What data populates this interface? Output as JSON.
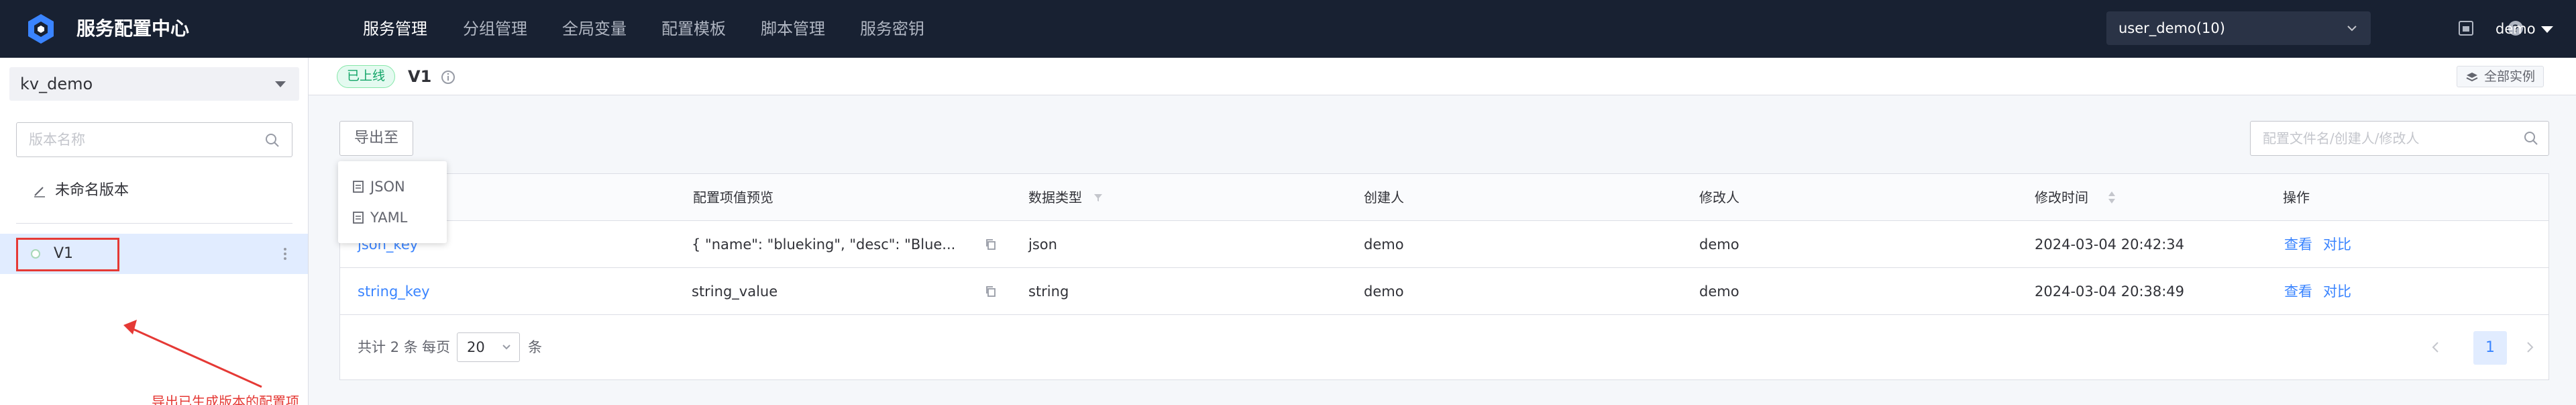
{
  "app": {
    "title": "服务配置中心"
  },
  "nav": {
    "items": [
      {
        "label": "服务管理",
        "active": true
      },
      {
        "label": "分组管理",
        "active": false
      },
      {
        "label": "全局变量",
        "active": false
      },
      {
        "label": "配置模板",
        "active": false
      },
      {
        "label": "脚本管理",
        "active": false
      },
      {
        "label": "服务密钥",
        "active": false
      }
    ]
  },
  "header": {
    "business": "user_demo(10)",
    "user": "demo"
  },
  "sidebar": {
    "service": "kv_demo",
    "search_placeholder": "版本名称",
    "unnamed_label": "未命名版本",
    "versions": [
      {
        "label": "V1",
        "selected": true
      }
    ]
  },
  "annotation": {
    "text": "导出已生成版本的配置项",
    "color": "#e53935"
  },
  "version_header": {
    "status": "已上线",
    "name": "V1",
    "all_instances": "全部实例"
  },
  "toolbar": {
    "export_label": "导出至",
    "search_placeholder": "配置文件名/创建人/修改人"
  },
  "export_menu": {
    "items": [
      "JSON",
      "YAML"
    ]
  },
  "table": {
    "columns": [
      "配置项值预览",
      "数据类型",
      "创建人",
      "修改人",
      "修改时间",
      "操作"
    ],
    "rows": [
      {
        "key": "json_key",
        "value": "{ \"name\": \"blueking\", \"desc\": \"Blue...",
        "type": "json",
        "creator": "demo",
        "modifier": "demo",
        "time": "2024-03-04 20:42:34",
        "view": "查看",
        "diff": "对比"
      },
      {
        "key": "string_key",
        "value": "string_value",
        "type": "string",
        "creator": "demo",
        "modifier": "demo",
        "time": "2024-03-04 20:38:49",
        "view": "查看",
        "diff": "对比"
      }
    ]
  },
  "pagination": {
    "total_prefix": "共计",
    "total": "2",
    "total_suffix": "条",
    "per_page_label": "每页",
    "page_size": "20",
    "per_page_suffix": "条",
    "current_page": "1"
  },
  "colors": {
    "topbar": "#182132",
    "accent": "#3a84ff",
    "success": "#14a568",
    "annotation": "#e53935"
  },
  "icons": [
    "logo-icon",
    "chevron-down-icon",
    "fullscreen-icon",
    "help-icon",
    "search-icon",
    "edit-icon",
    "more-icon",
    "info-icon",
    "layers-icon",
    "filter-icon",
    "sort-icon",
    "copy-icon",
    "doc-icon",
    "chevron-left-icon",
    "chevron-right-icon"
  ]
}
